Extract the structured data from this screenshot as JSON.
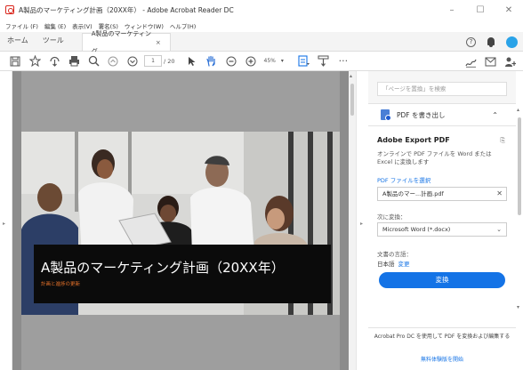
{
  "window": {
    "title": "A製品のマーケティング計画（20XX年） - Adobe Acrobat Reader DC",
    "minimize": "–",
    "maximize": "☐",
    "close": "✕"
  },
  "menu": [
    "ファイル (F)",
    "編集 (E)",
    "表示(V)",
    "署名(S)",
    "ウィンドウ(W)",
    "ヘルプ(H)"
  ],
  "tabs": {
    "home": "ホーム",
    "tools": "ツール",
    "doc": "A製品のマーケティング...",
    "doc_close": "×",
    "help": "?"
  },
  "toolbar": {
    "page_current": "1",
    "page_total": "/ 20",
    "zoom": "45%",
    "zoom_caret": "▾",
    "more": "···"
  },
  "document": {
    "title": "A製品のマーケティング計画（20XX年）",
    "subtitle": "計画と進捗の更新"
  },
  "panel": {
    "search_placeholder": "「ページを置換」を検索",
    "pane_label": "PDF を書き出し",
    "export_title": "Adobe Export PDF",
    "export_desc": "オンラインで PDF ファイルを Word または Excel に変換します",
    "select_file": "PDF ファイルを選択",
    "file_name": "A製品のマー...計画.pdf",
    "convert_to_label": "次に変換：",
    "format": "Microsoft Word (*.docx)",
    "lang_label": "文書の言語：",
    "lang_value": "日本語",
    "lang_change": "変更",
    "convert_button": "変換",
    "promo_text": "Acrobat Pro DC を使用して PDF を変換および編集する",
    "trial_link": "無料体験版を開始"
  },
  "colors": {
    "accent": "#1473e6",
    "doc_bg": "#8c8c8c",
    "caption_bg": "#0b0b0b",
    "subtitle": "#e8732a"
  }
}
